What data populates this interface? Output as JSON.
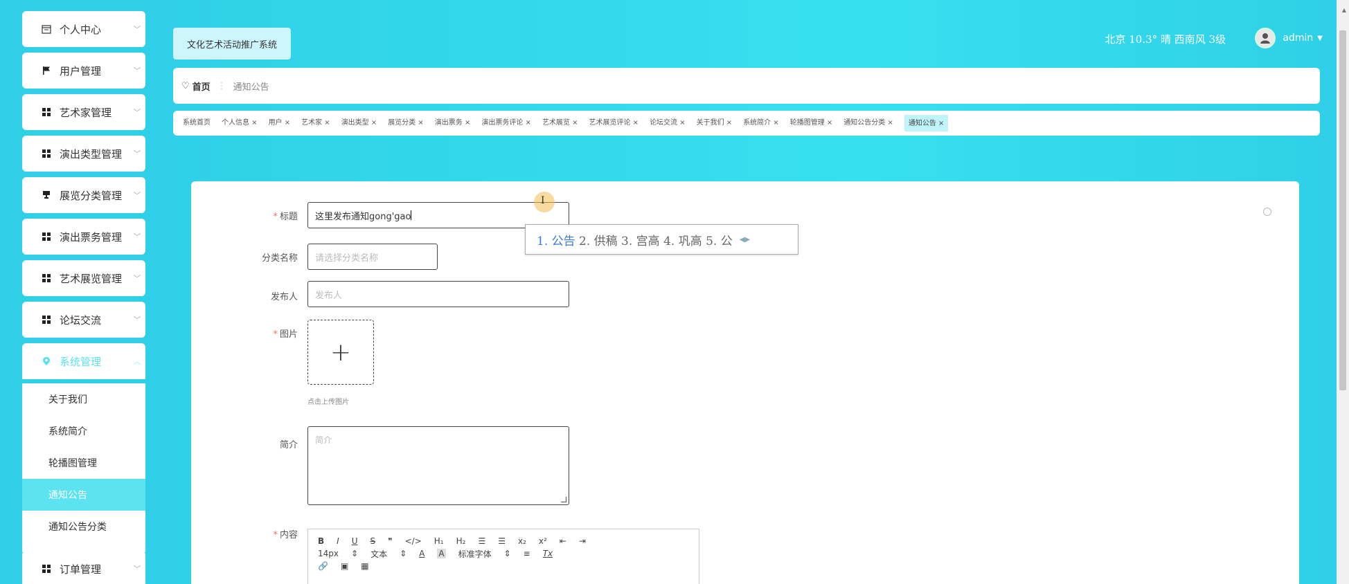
{
  "sidebar": {
    "menu": [
      {
        "label": "个人中心",
        "icon": "calendar-icon",
        "arrow": "﹀"
      },
      {
        "label": "用户管理",
        "icon": "flag-icon",
        "arrow": "﹀"
      },
      {
        "label": "艺术家管理",
        "icon": "grid-icon",
        "arrow": "﹀"
      },
      {
        "label": "演出类型管理",
        "icon": "grid-icon",
        "arrow": "﹀"
      },
      {
        "label": "展览分类管理",
        "icon": "trophy-icon",
        "arrow": "﹀"
      },
      {
        "label": "演出票务管理",
        "icon": "grid-icon",
        "arrow": "﹀"
      },
      {
        "label": "艺术展览管理",
        "icon": "grid-icon",
        "arrow": "﹀"
      },
      {
        "label": "论坛交流",
        "icon": "grid-icon",
        "arrow": "﹀"
      },
      {
        "label": "系统管理",
        "icon": "location-icon",
        "arrow": "︿"
      },
      {
        "label": "订单管理",
        "icon": "grid-icon",
        "arrow": "﹀"
      }
    ],
    "submenu": [
      {
        "label": "关于我们"
      },
      {
        "label": "系统简介"
      },
      {
        "label": "轮播图管理"
      },
      {
        "label": "通知公告"
      },
      {
        "label": "通知公告分类"
      }
    ],
    "accent_color": "#5ce3f2"
  },
  "header": {
    "system_title": "文化艺术活动推广系统",
    "weather": "北京 10.3° 晴 西南风 3级",
    "username": "admin",
    "caret": "▼"
  },
  "breadcrumb": {
    "home_icon": "♡",
    "home": "首页",
    "separator": "⋮",
    "current": "通知公告"
  },
  "tabs": [
    "系统首页",
    "个人信息 ×",
    "用户 ×",
    "艺术家 ×",
    "演出类型 ×",
    "展览分类 ×",
    "演出票务 ×",
    "演出票务评论 ×",
    "艺术展览 ×",
    "艺术展览评论 ×",
    "论坛交流 ×",
    "关于我们 ×",
    "系统简介 ×",
    "轮播图管理 ×",
    "通知公告分类 ×",
    "通知公告 ×"
  ],
  "form": {
    "title": {
      "label": "标题",
      "required": "*",
      "value": "这里发布通知gong'gao"
    },
    "category": {
      "label": "分类名称",
      "placeholder": "请选择分类名称"
    },
    "publisher": {
      "label": "发布人",
      "placeholder": "发布人"
    },
    "image": {
      "label": "图片",
      "required": "*",
      "plus": "+",
      "hint": "点击上传图片"
    },
    "intro": {
      "label": "简介",
      "placeholder": "简介"
    },
    "content": {
      "label": "内容",
      "required": "*",
      "toolbar_row1": [
        "B",
        "I",
        "U",
        "S",
        "❞",
        "</>",
        "H₁",
        "H₂",
        "☰",
        "☰",
        "x₂",
        "x²",
        "⇤",
        "⇥"
      ],
      "toolbar_row2": [
        "14px",
        "⇕",
        "文本",
        "⇕",
        "A",
        "A",
        "标准字体",
        "⇕",
        "≡",
        "Tx"
      ],
      "toolbar_row3": [
        "🔗",
        "▣",
        "▦"
      ]
    }
  },
  "ime": {
    "candidate1": "1. 公告",
    "others": "2. 供稿  3. 宫高  4. 巩高  5. 公",
    "arrows": "◀▶"
  },
  "cursor_glyph": "I"
}
